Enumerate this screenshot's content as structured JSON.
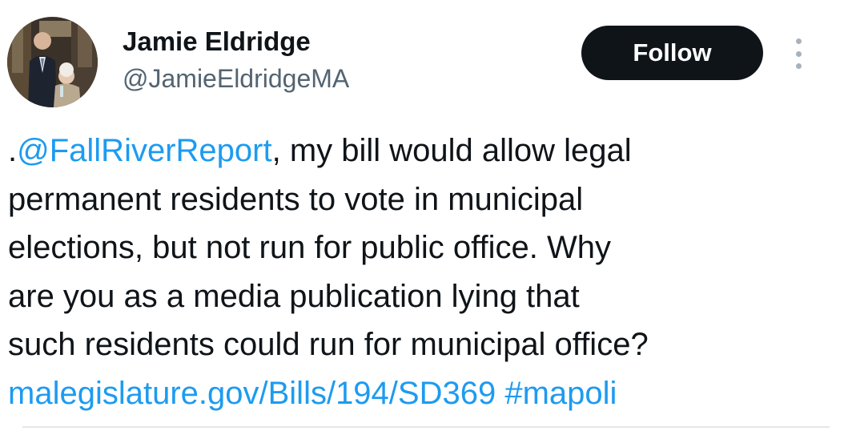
{
  "author": {
    "display_name": "Jamie Eldridge",
    "handle": "@JamieEldridgeMA",
    "avatar_icon": "profile-photo"
  },
  "actions": {
    "follow_label": "Follow",
    "more_icon": "vertical-ellipsis-icon"
  },
  "tweet": {
    "line1_prefix": ".",
    "mention": "@FallRiverReport",
    "line1_rest": ", my bill would allow legal",
    "line2": "permanent residents to vote in municipal",
    "line3": "elections, but not run for public office. Why",
    "line4": "are you as a media publication lying that",
    "line5": "such residents could run for municipal office?",
    "url": "malegislature.gov/Bills/194/SD369",
    "hashtag": "#mapoli"
  },
  "colors": {
    "text": "#0f1419",
    "secondary_text": "#536471",
    "link": "#1d9bf0",
    "button_bg": "#0f1419",
    "button_text": "#ffffff"
  }
}
